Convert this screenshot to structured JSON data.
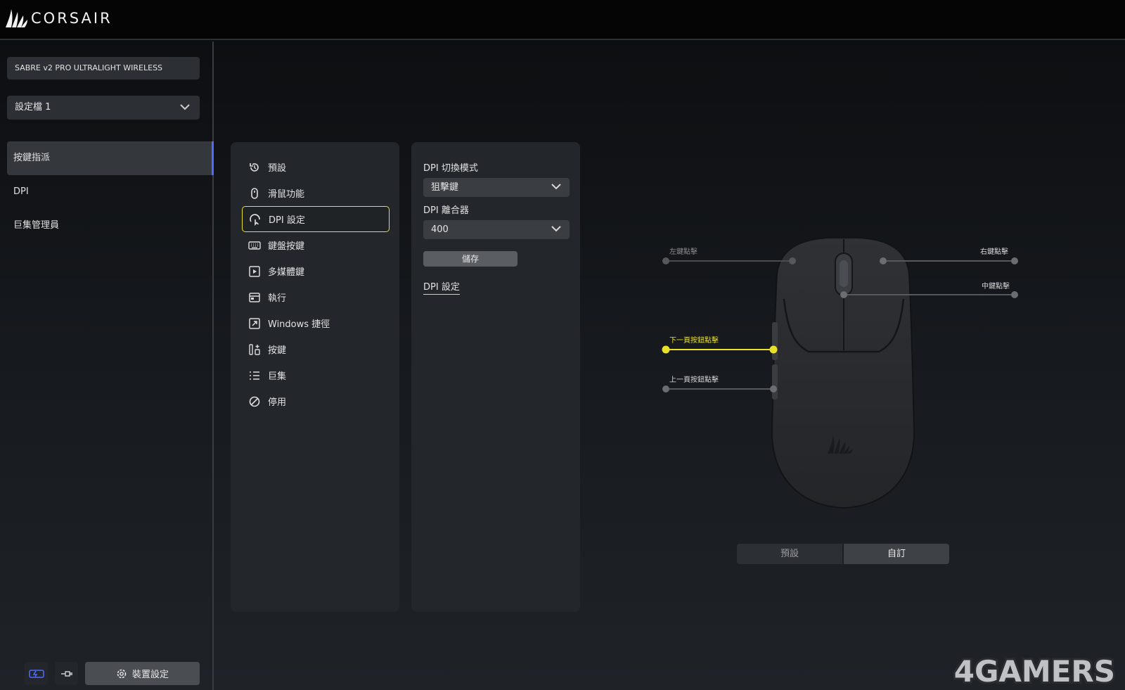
{
  "app": {
    "brand": "CORSAIR"
  },
  "sidebar": {
    "device_name": "SABRE v2 PRO ULTRALIGHT WIRELESS",
    "profile": "設定檔 1",
    "items": [
      {
        "label": "按鍵指派",
        "active": true
      },
      {
        "label": "DPI",
        "active": false
      },
      {
        "label": "巨集管理員",
        "active": false
      }
    ],
    "device_settings_label": "裝置設定"
  },
  "actions": {
    "items": [
      {
        "label": "預設",
        "icon": "reset-icon"
      },
      {
        "label": "滑鼠功能",
        "icon": "mouse-icon"
      },
      {
        "label": "DPI 設定",
        "icon": "dpi-icon",
        "selected": true
      },
      {
        "label": "鍵盤按鍵",
        "icon": "keyboard-icon"
      },
      {
        "label": "多媒體鍵",
        "icon": "media-icon"
      },
      {
        "label": "執行",
        "icon": "launch-icon"
      },
      {
        "label": "Windows 捷徑",
        "icon": "shortcut-icon"
      },
      {
        "label": "按鍵",
        "icon": "key-icon"
      },
      {
        "label": "巨集",
        "icon": "list-icon"
      },
      {
        "label": "停用",
        "icon": "disable-icon"
      }
    ]
  },
  "dpi_panel": {
    "switch_mode_label": "DPI 切換模式",
    "switch_mode_value": "狙擊鍵",
    "clutch_label": "DPI 離合器",
    "clutch_value": "400",
    "save_label": "儲存",
    "dpi_settings_link": "DPI 設定"
  },
  "mouse": {
    "callouts": {
      "left_click": "左鍵點擊",
      "right_click": "右鍵點擊",
      "middle_click": "中鍵點擊",
      "forward_click": "下一頁按鈕點擊",
      "back_click": "上一頁按鈕點擊"
    },
    "highlight_color": "#e9e02a"
  },
  "view_toggle": {
    "default_label": "預設",
    "custom_label": "自訂",
    "selected": "自訂"
  },
  "watermark": "4GAMERS"
}
